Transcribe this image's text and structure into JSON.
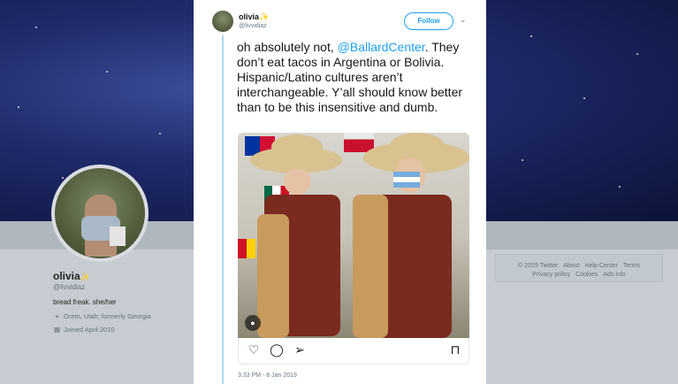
{
  "profile": {
    "name": "olivia",
    "name_badge": "✨",
    "handle": "@livvidiaz",
    "bio": "bread freak. she/her",
    "location": "Orem, Utah; formerly Georgia",
    "joined": "Joined April 2010",
    "location_icon": "location-pin-icon",
    "calendar_icon": "calendar-icon"
  },
  "footer": {
    "links": [
      "© 2019 Twitter",
      "About",
      "Help Center",
      "Terms",
      "Privacy policy",
      "Cookies",
      "Ads info"
    ]
  },
  "tweet": {
    "name": "olivia",
    "name_badge": "✨",
    "handle": "@livvidiaz",
    "follow_label": "Follow",
    "text_before": "oh absolutely not, ",
    "mention": "@BallardCenter",
    "text_after": ". They don’t eat tacos in Argentina or Bolivia. Hispanic/Latino cultures aren’t interchangeable. Y’all should know better than to be this insensitive and dumb.",
    "timestamp": "3:33 PM - 8 Jan 2019",
    "actions": [
      "like-icon",
      "reply-icon",
      "share-icon",
      "bookmark-icon"
    ]
  },
  "colors": {
    "accent": "#1da1f2",
    "thread_line": "#aed8f5",
    "badge": "#f5a623"
  }
}
